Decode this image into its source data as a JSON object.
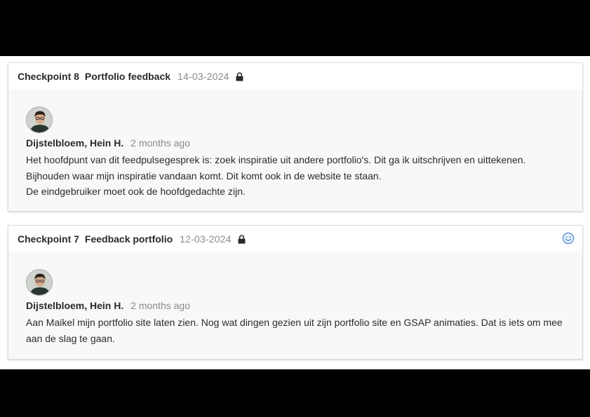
{
  "colors": {
    "backdrop": "#000000",
    "card_header_bg": "#ffffff",
    "card_body_bg": "#f8f8f8",
    "text": "#2a2a2a",
    "muted": "#8a8a8a",
    "smiley_accent": "#5b8fd6"
  },
  "checkpoints": [
    {
      "label": "Checkpoint 8",
      "title": "Portfolio feedback",
      "date": "14-03-2024",
      "lock_icon": "lock-icon",
      "comment": {
        "author": "Dijstelbloem, Hein H.",
        "time_ago": "2 months ago",
        "lines": [
          "Het hoofdpunt van dit feedpulsegesprek is: zoek inspiratie uit andere portfolio's. Dit ga ik uitschrijven en uittekenen.",
          "Bijhouden waar mijn inspiratie vandaan komt. Dit komt ook in de website te staan.",
          "De eindgebruiker moet ook de hoofdgedachte zijn."
        ]
      }
    },
    {
      "label": "Checkpoint 7",
      "title": "Feedback portfolio",
      "date": "12-03-2024",
      "lock_icon": "lock-icon",
      "reaction_icon": "smiley-icon",
      "comment": {
        "author": "Dijstelbloem, Hein H.",
        "time_ago": "2 months ago",
        "text": "Aan Maikel mijn portfolio site laten zien. Nog wat dingen gezien uit zijn portfolio site en GSAP animaties. Dat is iets om mee aan de slag te gaan."
      }
    }
  ]
}
